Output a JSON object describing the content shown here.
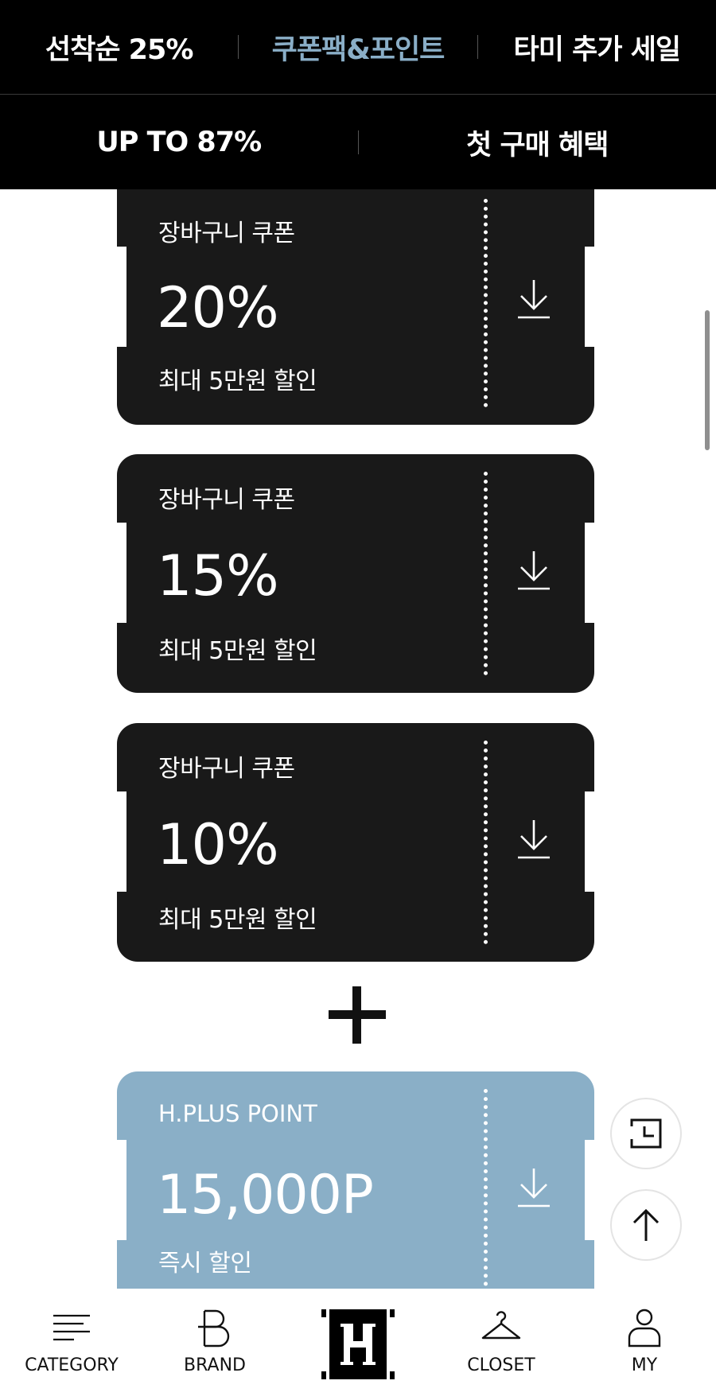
{
  "top_tabs": {
    "row1": [
      {
        "label": "선착순 25%"
      },
      {
        "label": "쿠폰팩&포인트",
        "active": true
      },
      {
        "label": "타미 추가 세일"
      }
    ],
    "row2": [
      {
        "label": "UP TO 87%"
      },
      {
        "label": "첫 구매 혜택"
      }
    ]
  },
  "coupons": [
    {
      "label": "장바구니 쿠폰",
      "value": "20%",
      "desc": "최대 5만원 할인",
      "icon": "download-icon"
    },
    {
      "label": "장바구니 쿠폰",
      "value": "15%",
      "desc": "최대 5만원 할인",
      "icon": "download-icon"
    },
    {
      "label": "장바구니 쿠폰",
      "value": "10%",
      "desc": "최대 5만원 할인",
      "icon": "download-icon"
    }
  ],
  "combine_icon": "plus-icon",
  "point": {
    "label": "H.PLUS POINT",
    "value": "15,000P",
    "desc": "즉시 할인",
    "icon": "download-icon"
  },
  "floating": {
    "recent_icon": "recent-view-icon",
    "top_icon": "arrow-up-icon"
  },
  "bottom_nav": {
    "category": "CATEGORY",
    "brand": "BRAND",
    "home_icon": "h-logo-icon",
    "closet": "CLOSET",
    "my": "MY"
  },
  "colors": {
    "background": "#ffffff",
    "nav": "#000000",
    "active_tab": "#8aaec7",
    "coupon": "#191919",
    "point": "#8aafc7"
  }
}
